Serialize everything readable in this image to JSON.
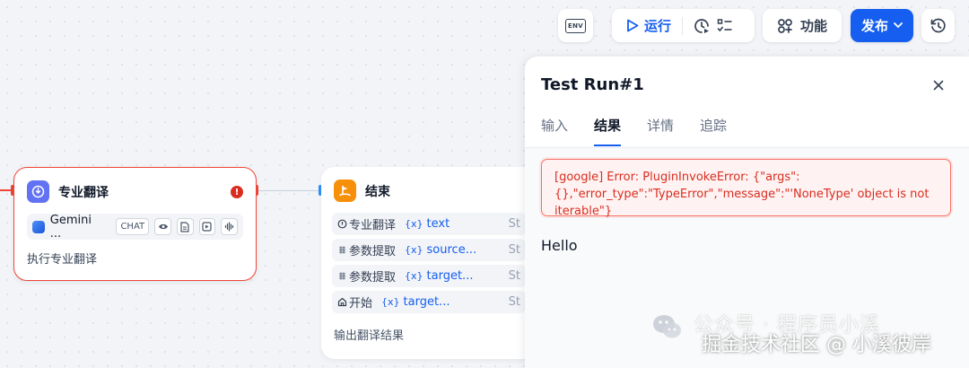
{
  "toolbar": {
    "env_label": "ENV",
    "run_label": "运行",
    "features_label": "功能",
    "publish_label": "发布"
  },
  "nodes": {
    "translate": {
      "title": "专业翻译",
      "model_name": "Gemini ...",
      "model_tag": "CHAT",
      "description": "执行专业翻译"
    },
    "end": {
      "title": "结束",
      "variables": [
        {
          "source": "专业翻译",
          "var": "text",
          "type": "St"
        },
        {
          "source": "参数提取",
          "var": "source...",
          "type": "St"
        },
        {
          "source": "参数提取",
          "var": "target...",
          "type": "St"
        },
        {
          "source": "开始",
          "var": "target...",
          "type": "St"
        }
      ],
      "description": "输出翻译结果"
    }
  },
  "panel": {
    "title": "Test Run#1",
    "tabs": [
      "输入",
      "结果",
      "详情",
      "追踪"
    ],
    "active_tab": "结果",
    "error_message": "[google] Error: PluginInvokeError: {\"args\":{},\"error_type\":\"TypeError\",\"message\":\"'NoneType' object is not iterable\"}",
    "result_text": "Hello"
  },
  "watermark": {
    "line1": "公众号 · 程序员小溪",
    "line2": "掘金技术社区 @ 小溪彼岸"
  },
  "colors": {
    "primary": "#155eef",
    "error": "#f04438",
    "translate_icon_bg": "#6172f3",
    "end_icon_bg": "#f79009"
  }
}
